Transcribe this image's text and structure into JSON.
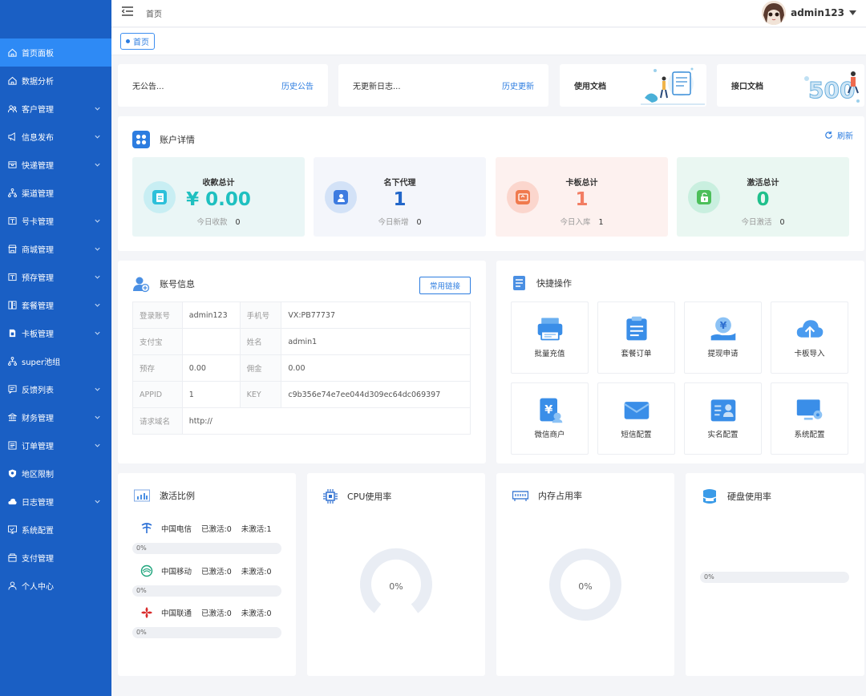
{
  "sidebar": {
    "items": [
      {
        "label": "首页面板",
        "icon": "home-icon",
        "active": true,
        "expandable": false
      },
      {
        "label": "数据分析",
        "icon": "home-icon",
        "active": false,
        "expandable": false
      },
      {
        "label": "客户管理",
        "icon": "users-icon",
        "active": false,
        "expandable": true
      },
      {
        "label": "信息发布",
        "icon": "megaphone-icon",
        "active": false,
        "expandable": true
      },
      {
        "label": "快递管理",
        "icon": "box-icon",
        "active": false,
        "expandable": true
      },
      {
        "label": "渠道管理",
        "icon": "network-icon",
        "active": false,
        "expandable": false
      },
      {
        "label": "号卡管理",
        "icon": "card-icon",
        "active": false,
        "expandable": true
      },
      {
        "label": "商城管理",
        "icon": "store-icon",
        "active": false,
        "expandable": true
      },
      {
        "label": "预存管理",
        "icon": "card-icon",
        "active": false,
        "expandable": true
      },
      {
        "label": "套餐管理",
        "icon": "book-icon",
        "active": false,
        "expandable": true
      },
      {
        "label": "卡板管理",
        "icon": "sim-icon",
        "active": false,
        "expandable": true
      },
      {
        "label": "super池组",
        "icon": "network-icon",
        "active": false,
        "expandable": false
      },
      {
        "label": "反馈列表",
        "icon": "feedback-icon",
        "active": false,
        "expandable": true
      },
      {
        "label": "财务管理",
        "icon": "bank-icon",
        "active": false,
        "expandable": true
      },
      {
        "label": "订单管理",
        "icon": "list-icon",
        "active": false,
        "expandable": true
      },
      {
        "label": "地区限制",
        "icon": "shield-icon",
        "active": false,
        "expandable": false
      },
      {
        "label": "日志管理",
        "icon": "cloud-icon",
        "active": false,
        "expandable": true
      },
      {
        "label": "系统配置",
        "icon": "monitor-icon",
        "active": false,
        "expandable": false
      },
      {
        "label": "支付管理",
        "icon": "wallet-icon",
        "active": false,
        "expandable": false
      },
      {
        "label": "个人中心",
        "icon": "user-icon",
        "active": false,
        "expandable": false
      }
    ]
  },
  "topbar": {
    "breadcrumb": "首页",
    "username": "admin123"
  },
  "tabs": {
    "home": "首页"
  },
  "notices": {
    "announce_text": "无公告...",
    "announce_link": "历史公告",
    "update_text": "无更新日志...",
    "update_link": "历史更新",
    "usage_doc": "使用文档",
    "api_doc": "接口文档"
  },
  "account": {
    "title": "账户详情",
    "refresh": "刷新",
    "stats": [
      {
        "label": "收款总计",
        "value": "¥ 0.00",
        "sub_label": "今日收款",
        "sub_value": "0",
        "color": "#1fc0c0",
        "bg": "#eaf6f6",
        "circle": "#c8eef3",
        "icon_bg": "#2cc0da"
      },
      {
        "label": "名下代理",
        "value": "1",
        "sub_label": "今日新增",
        "sub_value": "0",
        "color": "#2367c9",
        "bg": "#f4f6fb",
        "circle": "#d3e2f7",
        "icon_bg": "#3d7be0"
      },
      {
        "label": "卡板总计",
        "value": "1",
        "sub_label": "今日入库",
        "sub_value": "1",
        "color": "#f27d63",
        "bg": "#fdf1ef",
        "circle": "#fbd6cd",
        "icon_bg": "#f07a4d"
      },
      {
        "label": "激活总计",
        "value": "0",
        "sub_label": "今日激活",
        "sub_value": "0",
        "color": "#20c08c",
        "bg": "#eaf7f2",
        "circle": "#c9efdf",
        "icon_bg": "#4cbf5a"
      }
    ]
  },
  "info": {
    "title": "账号信息",
    "link_button": "常用链接",
    "rows": [
      [
        "登录账号",
        "admin123",
        "手机号",
        "VX:PB77737"
      ],
      [
        "支付宝",
        "",
        "姓名",
        "admin1"
      ],
      [
        "预存",
        "0.00",
        "佣金",
        "0.00"
      ],
      [
        "APPID",
        "1",
        "KEY",
        "c9b356e74e7ee044d309ec64dc069397"
      ]
    ],
    "domain_label": "请求域名",
    "domain_value": "http://"
  },
  "quick": {
    "title": "快捷操作",
    "items": [
      {
        "label": "批量充值",
        "icon": "printer-icon"
      },
      {
        "label": "套餐订单",
        "icon": "clipboard-icon"
      },
      {
        "label": "提现申请",
        "icon": "yen-hand-icon"
      },
      {
        "label": "卡板导入",
        "icon": "cloud-upload-icon"
      },
      {
        "label": "微信商户",
        "icon": "yen-doc-icon"
      },
      {
        "label": "短信配置",
        "icon": "envelope-icon"
      },
      {
        "label": "实名配置",
        "icon": "id-card-icon"
      },
      {
        "label": "系统配置",
        "icon": "monitor-gear-icon"
      }
    ]
  },
  "activation": {
    "title": "激活比例",
    "carriers": [
      {
        "name": "中国电信",
        "activated": "已激活:0",
        "inactive": "未激活:1",
        "percent": "0%",
        "icon": "telecom-icon"
      },
      {
        "name": "中国移动",
        "activated": "已激活:0",
        "inactive": "未激活:0",
        "percent": "0%",
        "icon": "mobile-icon"
      },
      {
        "name": "中国联通",
        "activated": "已激活:0",
        "inactive": "未激活:0",
        "percent": "0%",
        "icon": "unicom-icon"
      }
    ]
  },
  "cpu": {
    "title": "CPU使用率",
    "value": "0%",
    "usage": 0
  },
  "memory": {
    "title": "内存占用率",
    "value": "0%",
    "usage": 0
  },
  "disk": {
    "title": "硬盘使用率",
    "value": "0%",
    "usage": 0
  }
}
